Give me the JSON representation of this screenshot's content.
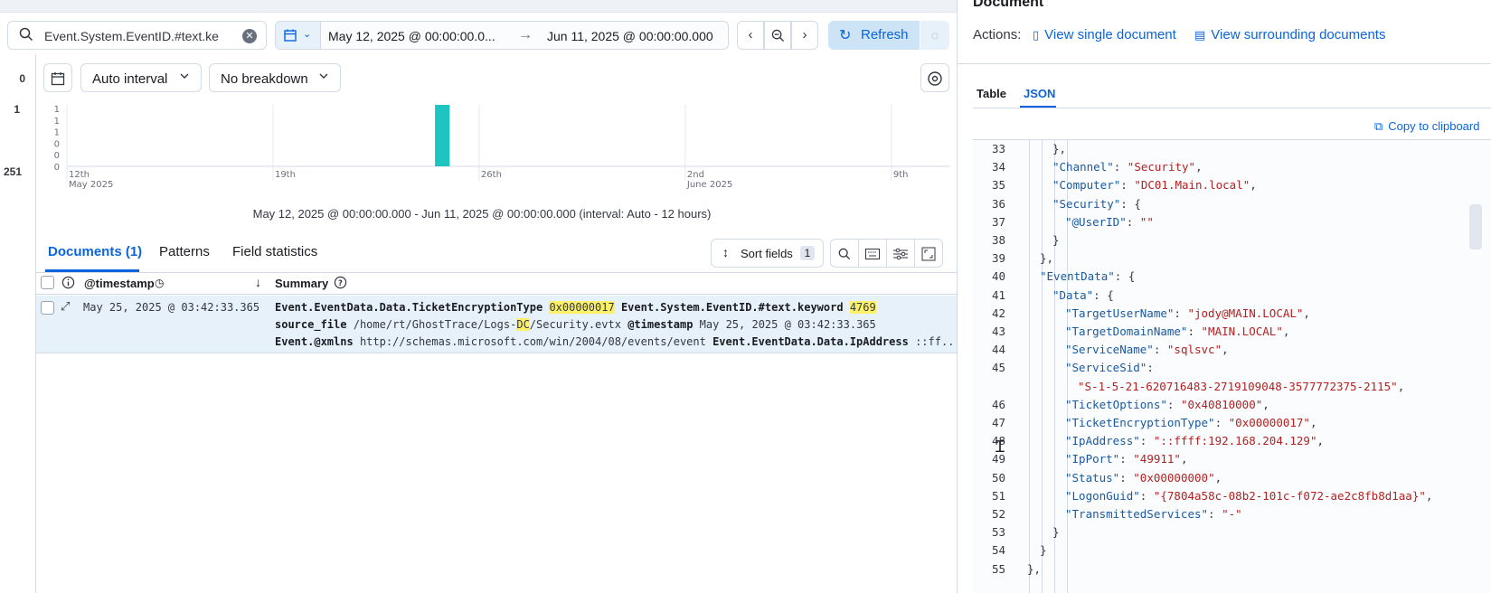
{
  "query": {
    "text": "Event.System.EventID.#text.ke",
    "search_icon": "search-icon",
    "clear_icon": "clear-icon"
  },
  "daterange": {
    "start": "May 12, 2025 @ 00:00:00.0...",
    "arrow": "→",
    "end": "Jun 11, 2025 @ 00:00:00.000"
  },
  "toolbar": {
    "refresh_label": "Refresh",
    "prev_icon": "chevron-left-icon",
    "zoom_icon": "zoom-out-icon",
    "next_icon": "chevron-right-icon"
  },
  "gutter": {
    "n1": "0",
    "n2": "1",
    "n3": "251"
  },
  "histogram": {
    "interval_label": "Auto interval",
    "breakdown_label": "No breakdown",
    "caption": "May 12, 2025 @ 00:00:00.000 - Jun 11, 2025 @ 00:00:00.000 (interval: Auto - 12 hours)"
  },
  "chart_data": {
    "type": "bar",
    "y_ticks": [
      "1",
      "1",
      "1",
      "0",
      "0",
      "0"
    ],
    "x_ticks": [
      {
        "label": "12th",
        "sub": "May 2025"
      },
      {
        "label": "19th",
        "sub": ""
      },
      {
        "label": "26th",
        "sub": ""
      },
      {
        "label": "2nd",
        "sub": "June 2025"
      },
      {
        "label": "9th",
        "sub": ""
      }
    ],
    "x_range": [
      "2025-05-12",
      "2025-06-11"
    ],
    "bars": [
      {
        "x": "2025-05-24T12:00",
        "value": 1
      }
    ],
    "ylim": [
      0,
      1
    ],
    "color": "#1ec5c0",
    "grid": true
  },
  "doctabs": {
    "documents": "Documents (1)",
    "patterns": "Patterns",
    "field_stats": "Field statistics"
  },
  "sort": {
    "label": "Sort fields",
    "count": "1"
  },
  "table": {
    "col_timestamp": "@timestamp",
    "col_summary": "Summary",
    "row": {
      "timestamp": "May 25, 2025 @ 03:42:33.365",
      "l1_k1": "Event.EventData.Data.TicketEncryptionType",
      "l1_v1": "0x00000017",
      "l1_k2": "Event.System.EventID.#text.keyword",
      "l1_v2": "4769",
      "l2_k1": "source_file",
      "l2_v1a": "/home/rt/GhostTrace/Logs-",
      "l2_v1b": "DC",
      "l2_v1c": "/Security.evtx",
      "l2_k2": "@timestamp",
      "l2_v2": "May 25, 2025 @ 03:42:33.365",
      "l3_k1": "Event.@xmlns",
      "l3_v1": "http://schemas.microsoft.com/win/2004/08/events/event",
      "l3_k2": "Event.EventData.Data.IpAddress",
      "l3_v2": "::ff..."
    }
  },
  "panel": {
    "title": "Document",
    "actions_label": "Actions:",
    "view_single": "View single document",
    "view_surrounding": "View surrounding documents",
    "tab_table": "Table",
    "tab_json": "JSON",
    "copy": "Copy to clipboard"
  },
  "json_lines": [
    {
      "n": "33",
      "indent": 3,
      "parts": [
        [
          "p",
          "},"
        ]
      ]
    },
    {
      "n": "34",
      "indent": 3,
      "parts": [
        [
          "k",
          "\"Channel\""
        ],
        [
          "p",
          ": "
        ],
        [
          "s",
          "\"Security\""
        ],
        [
          "p",
          ","
        ]
      ]
    },
    {
      "n": "35",
      "indent": 3,
      "parts": [
        [
          "k",
          "\"Computer\""
        ],
        [
          "p",
          ": "
        ],
        [
          "s",
          "\"DC01.Main.local\""
        ],
        [
          "p",
          ","
        ]
      ]
    },
    {
      "n": "36",
      "indent": 3,
      "parts": [
        [
          "k",
          "\"Security\""
        ],
        [
          "p",
          ": {"
        ]
      ]
    },
    {
      "n": "37",
      "indent": 4,
      "parts": [
        [
          "k",
          "\"@UserID\""
        ],
        [
          "p",
          ": "
        ],
        [
          "s",
          "\"\""
        ]
      ]
    },
    {
      "n": "38",
      "indent": 3,
      "parts": [
        [
          "p",
          "}"
        ]
      ]
    },
    {
      "n": "39",
      "indent": 2,
      "parts": [
        [
          "p",
          "},"
        ]
      ]
    },
    {
      "n": "40",
      "indent": 2,
      "parts": [
        [
          "k",
          "\"EventData\""
        ],
        [
          "p",
          ": {"
        ]
      ]
    },
    {
      "n": "41",
      "indent": 3,
      "parts": [
        [
          "k",
          "\"Data\""
        ],
        [
          "p",
          ": {"
        ]
      ]
    },
    {
      "n": "42",
      "indent": 4,
      "parts": [
        [
          "k",
          "\"TargetUserName\""
        ],
        [
          "p",
          ": "
        ],
        [
          "s",
          "\"jody@MAIN.LOCAL\""
        ],
        [
          "p",
          ","
        ]
      ]
    },
    {
      "n": "43",
      "indent": 4,
      "parts": [
        [
          "k",
          "\"TargetDomainName\""
        ],
        [
          "p",
          ": "
        ],
        [
          "s",
          "\"MAIN.LOCAL\""
        ],
        [
          "p",
          ","
        ]
      ]
    },
    {
      "n": "44",
      "indent": 4,
      "parts": [
        [
          "k",
          "\"ServiceName\""
        ],
        [
          "p",
          ": "
        ],
        [
          "s",
          "\"sqlsvc\""
        ],
        [
          "p",
          ","
        ]
      ]
    },
    {
      "n": "45",
      "indent": 4,
      "parts": [
        [
          "k",
          "\"ServiceSid\""
        ],
        [
          "p",
          ":"
        ]
      ]
    },
    {
      "n": "",
      "indent": 5,
      "parts": [
        [
          "s",
          "\"S-1-5-21-620716483-2719109048-3577772375-2115\""
        ],
        [
          "p",
          ","
        ]
      ]
    },
    {
      "n": "46",
      "indent": 4,
      "parts": [
        [
          "k",
          "\"TicketOptions\""
        ],
        [
          "p",
          ": "
        ],
        [
          "s",
          "\"0x40810000\""
        ],
        [
          "p",
          ","
        ]
      ]
    },
    {
      "n": "47",
      "indent": 4,
      "parts": [
        [
          "k",
          "\"TicketEncryptionType\""
        ],
        [
          "p",
          ": "
        ],
        [
          "s",
          "\"0x00000017\""
        ],
        [
          "p",
          ","
        ]
      ]
    },
    {
      "n": "48",
      "indent": 4,
      "parts": [
        [
          "k",
          "\"IpAddress\""
        ],
        [
          "p",
          ": "
        ],
        [
          "s",
          "\"::ffff:192.168.204.129\""
        ],
        [
          "p",
          ","
        ]
      ]
    },
    {
      "n": "49",
      "indent": 4,
      "parts": [
        [
          "k",
          "\"IpPort\""
        ],
        [
          "p",
          ": "
        ],
        [
          "s",
          "\"49911\""
        ],
        [
          "p",
          ","
        ]
      ]
    },
    {
      "n": "50",
      "indent": 4,
      "parts": [
        [
          "k",
          "\"Status\""
        ],
        [
          "p",
          ": "
        ],
        [
          "s",
          "\"0x00000000\""
        ],
        [
          "p",
          ","
        ]
      ]
    },
    {
      "n": "51",
      "indent": 4,
      "parts": [
        [
          "k",
          "\"LogonGuid\""
        ],
        [
          "p",
          ": "
        ],
        [
          "s",
          "\"{7804a58c-08b2-101c-f072-ae2c8fb8d1aa}\""
        ],
        [
          "p",
          ","
        ]
      ]
    },
    {
      "n": "52",
      "indent": 4,
      "parts": [
        [
          "k",
          "\"TransmittedServices\""
        ],
        [
          "p",
          ": "
        ],
        [
          "s",
          "\"-\""
        ]
      ]
    },
    {
      "n": "53",
      "indent": 3,
      "parts": [
        [
          "p",
          "}"
        ]
      ]
    },
    {
      "n": "54",
      "indent": 2,
      "parts": [
        [
          "p",
          "}"
        ]
      ]
    },
    {
      "n": "55",
      "indent": 1,
      "parts": [
        [
          "p",
          "},"
        ]
      ]
    }
  ]
}
